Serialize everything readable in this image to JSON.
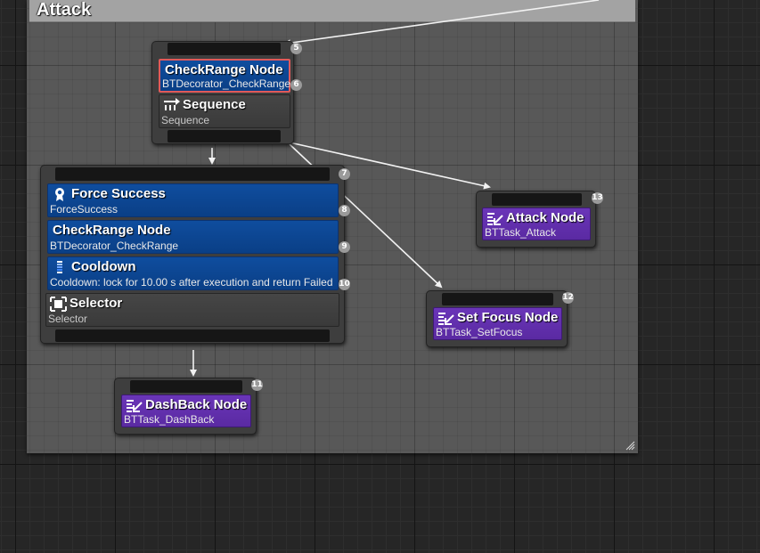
{
  "comment": {
    "title": "Attack"
  },
  "nodes": {
    "sequence": {
      "index": "5",
      "decorator": {
        "title": "CheckRange Node",
        "subtitle": "BTDecorator_CheckRange",
        "index": "6"
      },
      "composite": {
        "title": "Sequence",
        "subtitle": "Sequence",
        "icon": "sequence-icon"
      }
    },
    "selector": {
      "index": "7",
      "decorators": [
        {
          "title": "Force Success",
          "subtitle": "ForceSuccess",
          "index": "8",
          "icon": "force-success-icon"
        },
        {
          "title": "CheckRange Node",
          "subtitle": "BTDecorator_CheckRange",
          "index": "9"
        },
        {
          "title": "Cooldown",
          "subtitle": "Cooldown: lock for 10.00 s after execution and return Failed",
          "index": "10",
          "icon": "cooldown-icon"
        }
      ],
      "composite": {
        "title": "Selector",
        "subtitle": "Selector",
        "icon": "selector-icon"
      }
    },
    "dashback": {
      "index": "11",
      "title": "DashBack Node",
      "subtitle": "BTTask_DashBack",
      "icon": "task-icon"
    },
    "setfocus": {
      "index": "12",
      "title": "Set Focus Node",
      "subtitle": "BTTask_SetFocus",
      "icon": "task-icon"
    },
    "attack": {
      "index": "13",
      "title": "Attack Node",
      "subtitle": "BTTask_Attack",
      "icon": "task-icon"
    }
  },
  "colors": {
    "decorator": "#0f4d9e",
    "task": "#6a35b8",
    "composite": "#464646",
    "selected_outline": "#e05a5a",
    "comment_header": "#a3a3a3"
  }
}
